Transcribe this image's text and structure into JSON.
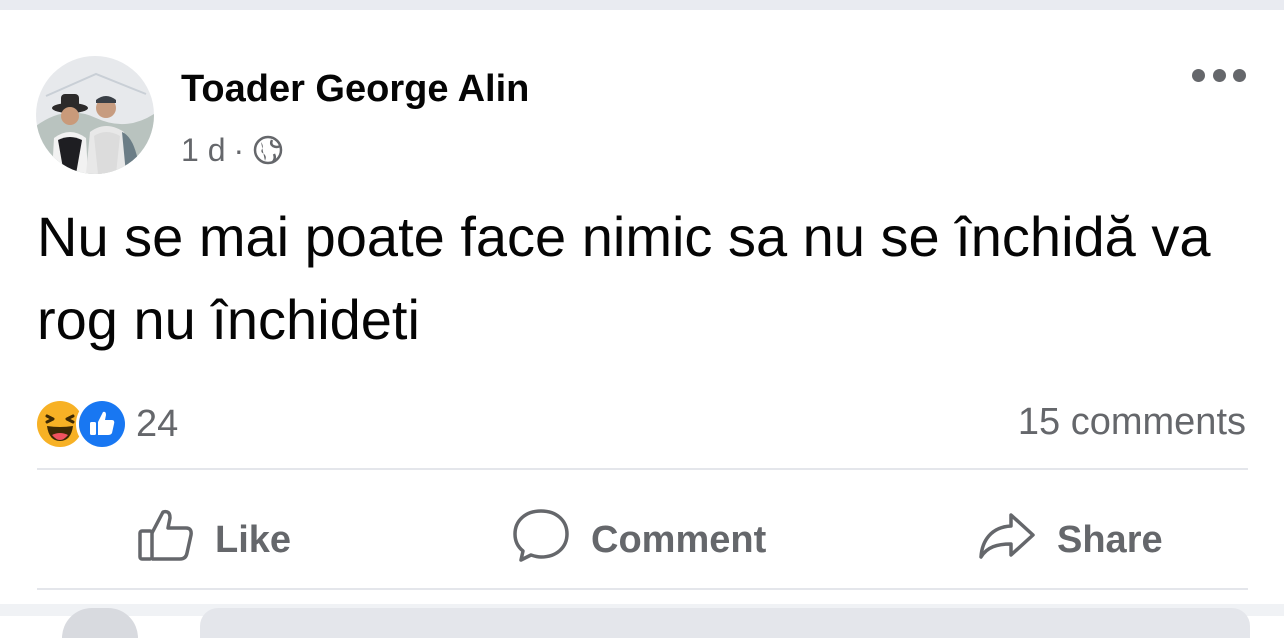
{
  "post": {
    "author": "Toader George Alin",
    "time": "1 d",
    "separator": "·",
    "audience_icon": "globe-icon",
    "menu_icon": "more-options-icon",
    "text": "Nu se mai poate face nimic sa nu se închidă va rog nu închideti",
    "reactions": {
      "icons": [
        "haha-reaction-icon",
        "like-reaction-icon"
      ],
      "count": "24"
    },
    "comments_count": "15 comments"
  },
  "actions": {
    "like": {
      "label": "Like",
      "icon": "thumbs-up-outline-icon"
    },
    "comment": {
      "label": "Comment",
      "icon": "speech-bubble-icon"
    },
    "share": {
      "label": "Share",
      "icon": "share-arrow-icon"
    }
  },
  "colors": {
    "text_primary": "#050505",
    "text_secondary": "#65676b",
    "divider": "#e4e6eb",
    "like_blue": "#1877f2",
    "haha_yellow": "#f7b125"
  }
}
